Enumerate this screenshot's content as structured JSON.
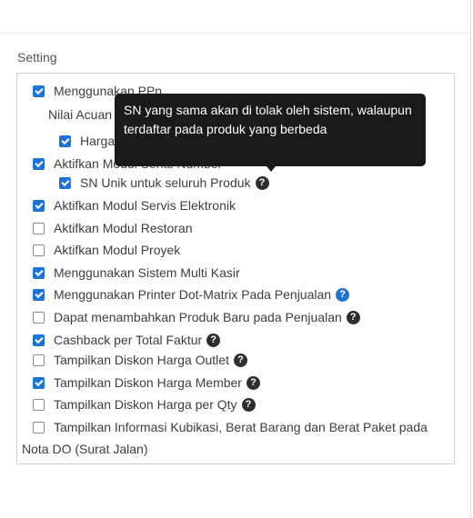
{
  "section_title": "Setting",
  "tooltip_text": "SN yang sama akan di tolak oleh sistem, walaupun terdaftar pada produk yang berbeda",
  "nilai_acuan_label": "Nilai Acuan",
  "settings": [
    {
      "label": "Menggunakan PPn",
      "checked": true
    },
    {
      "label": "Harga Jual Termasuk PPn",
      "checked": true
    },
    {
      "label": "Aktifkan Modul Serial Number",
      "checked": true
    },
    {
      "label": "SN Unik untuk seluruh Produk",
      "checked": true,
      "help_icon": "question-circle-icon"
    },
    {
      "label": "Aktifkan Modul Servis Elektronik",
      "checked": true
    },
    {
      "label": "Aktifkan Modul Restoran",
      "checked": false
    },
    {
      "label": "Aktifkan Modul Proyek",
      "checked": false
    },
    {
      "label": "Menggunakan Sistem Multi Kasir",
      "checked": true
    },
    {
      "label": "Menggunakan Printer Dot-Matrix Pada Penjualan",
      "checked": true,
      "help_icon": "question-circle-icon"
    },
    {
      "label": "Dapat menambahkan Produk Baru pada Penjualan",
      "checked": false,
      "help_icon": "question-circle-icon"
    },
    {
      "label": "Cashback per Total Faktur",
      "checked": true,
      "help_icon": "question-circle-icon"
    },
    {
      "label": "Tampilkan Diskon Harga Outlet",
      "checked": false,
      "help_icon": "question-circle-icon"
    },
    {
      "label": "Tampilkan Diskon Harga Member",
      "checked": true,
      "help_icon": "question-circle-icon"
    },
    {
      "label": "Tampilkan Diskon Harga per Qty",
      "checked": false,
      "help_icon": "question-circle-icon"
    },
    {
      "label": "Tampilkan Informasi Kubikasi, Berat Barang dan Berat Paket pada",
      "label_cont": "Nota DO (Surat Jalan)",
      "checked": false
    }
  ],
  "colors": {
    "accent": "#1e73d6",
    "tooltip_bg": "#1a1a1a",
    "help_dark": "#2e2e2e",
    "border": "#d2d2d2"
  }
}
